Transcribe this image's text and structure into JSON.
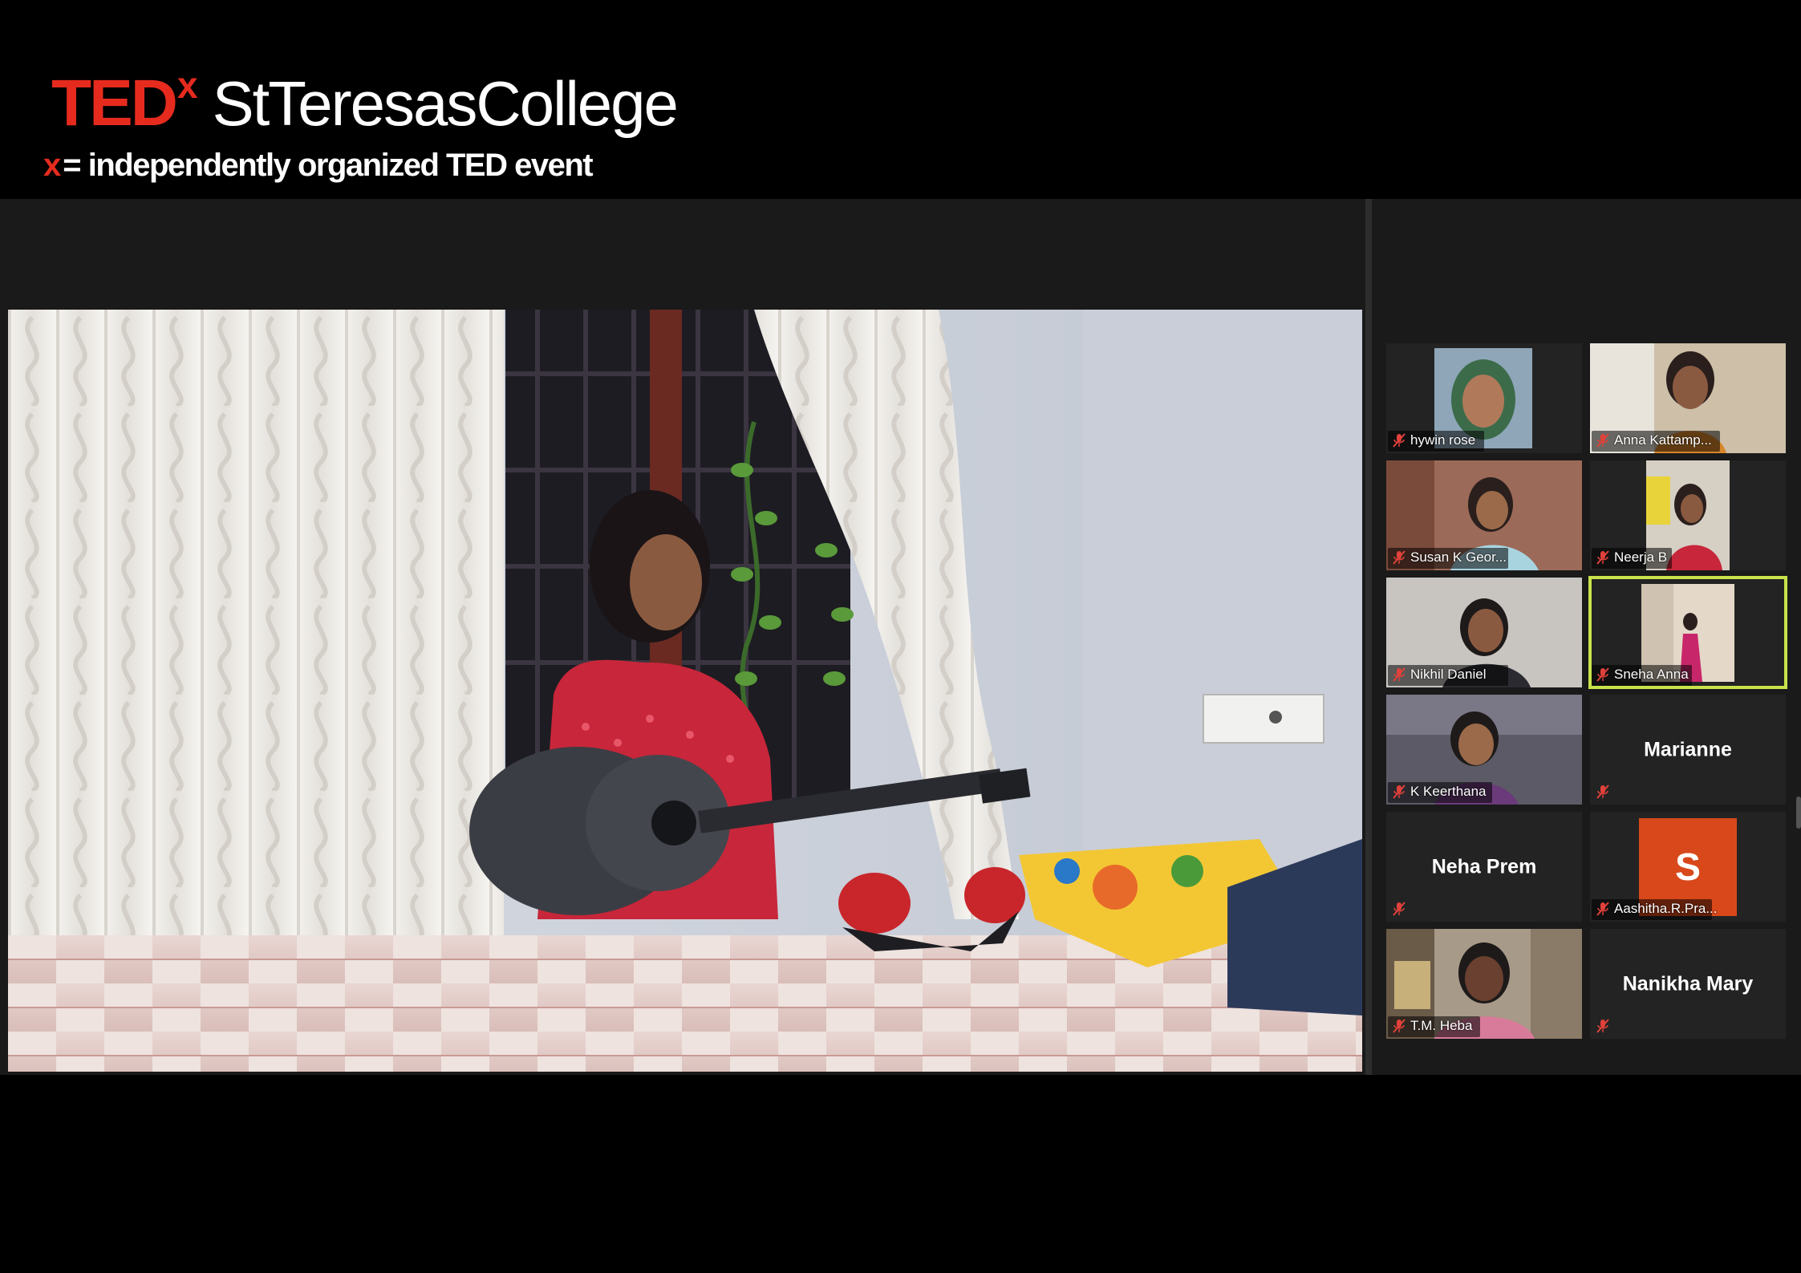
{
  "branding": {
    "ted": "TED",
    "x": "x",
    "event_name": "StTeresasCollege",
    "tag_x": "x",
    "tagline": "= independently organized  TED event"
  },
  "colors": {
    "ted_red": "#e62b1e",
    "active_speaker_border": "#c8e34a",
    "avatar_orange": "#d8481a",
    "mute_red": "#e0413a"
  },
  "participants": [
    {
      "name": "hywin rose",
      "muted": true,
      "type": "video"
    },
    {
      "name": "Anna Kattamp...",
      "muted": true,
      "type": "video"
    },
    {
      "name": "Susan K Geor...",
      "muted": true,
      "type": "video"
    },
    {
      "name": "Neerja B",
      "muted": true,
      "type": "video"
    },
    {
      "name": "Nikhil Daniel",
      "muted": true,
      "type": "video"
    },
    {
      "name": "Sneha Anna",
      "muted": true,
      "type": "video",
      "active": true
    },
    {
      "name": "K Keerthana",
      "muted": true,
      "type": "video"
    },
    {
      "name": "Marianne",
      "muted": true,
      "type": "name-only"
    },
    {
      "name": "Neha Prem",
      "muted": true,
      "type": "name-only"
    },
    {
      "name": "Aashitha.R.Pra...",
      "avatar_letter": "S",
      "muted": true,
      "type": "avatar"
    },
    {
      "name": "T.M. Heba",
      "muted": true,
      "type": "video"
    },
    {
      "name": "Nanikha Mary",
      "muted": true,
      "type": "name-only"
    }
  ]
}
